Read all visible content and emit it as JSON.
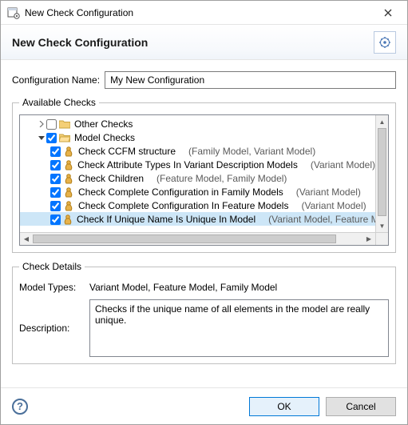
{
  "window": {
    "title": "New Check Configuration",
    "header": "New Check Configuration"
  },
  "config_name_label": "Configuration Name:",
  "config_name_value": "My New Configuration",
  "available_group_label": "Available Checks",
  "tree": {
    "other_checks": "Other Checks",
    "model_checks": "Model Checks",
    "items": [
      {
        "name": "Check CCFM structure",
        "hint": "(Family Model, Variant Model)"
      },
      {
        "name": "Check Attribute Types In Variant Description Models",
        "hint": "(Variant Model)"
      },
      {
        "name": "Check Children",
        "hint": "(Feature Model, Family Model)"
      },
      {
        "name": "Check Complete Configuration in Family Models",
        "hint": "(Variant Model)"
      },
      {
        "name": "Check Complete Configuration In Feature Models",
        "hint": "(Variant Model)"
      },
      {
        "name": "Check If Unique Name Is Unique In Model",
        "hint": "(Variant Model, Feature Mo"
      }
    ]
  },
  "details": {
    "group_label": "Check Details",
    "model_types_label": "Model Types:",
    "model_types_value": "Variant Model, Feature Model, Family Model",
    "description_label": "Description:",
    "description_value": "Checks if the unique name of all elements in the model are really unique."
  },
  "buttons": {
    "ok": "OK",
    "cancel": "Cancel"
  }
}
